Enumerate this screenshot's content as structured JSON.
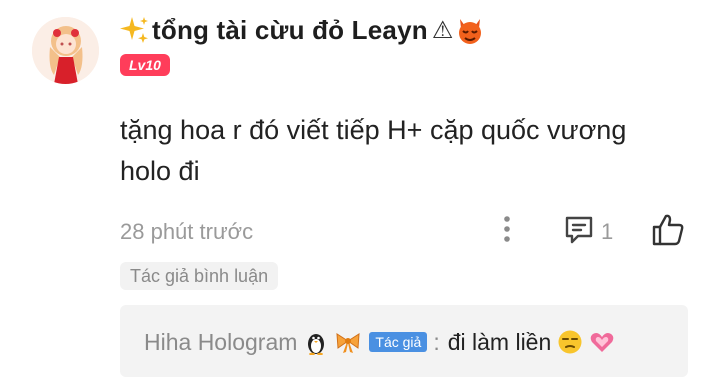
{
  "comment": {
    "username": "tổng tài cừu đỏ Leayn",
    "warning_symbol": "⚠",
    "level": "Lv10",
    "text": "tặng hoa r đó viết tiếp H+ cặp quốc vương holo đi",
    "timestamp": "28 phút trước",
    "reply_count": "1",
    "author_tag": "Tác giả bình luận",
    "icons": [
      "sparkle-icon",
      "devil-face-icon",
      "more-vertical-icon",
      "reply-icon",
      "like-icon"
    ]
  },
  "reply": {
    "username": "Hiha Hologram",
    "author_badge": "Tác giả",
    "colon": ":",
    "text": "đi làm liền",
    "icons": [
      "penguin-icon",
      "bow-icon",
      "unamused-face-icon",
      "heart-icon"
    ]
  },
  "colors": {
    "level_badge": "#ff3d5a",
    "author_badge": "#4a90e2",
    "muted_text": "#9a9a9a",
    "reply_background": "#f3f3f3"
  }
}
